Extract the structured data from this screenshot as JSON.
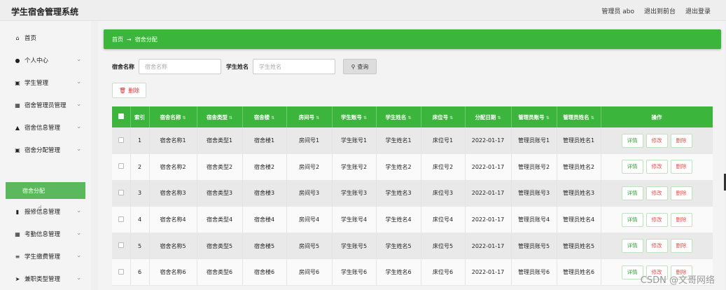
{
  "app": {
    "title": "学生宿舍管理系统",
    "user_label": "管理员 abo",
    "front_link": "退出到前台",
    "logout_link": "退出登录"
  },
  "sidebar": {
    "items": [
      {
        "label": "首页",
        "icon": "home-icon",
        "glyph": "⌂",
        "has_chevron": false
      },
      {
        "label": "个人中心",
        "icon": "user-icon",
        "glyph": "●",
        "has_chevron": true
      },
      {
        "label": "学生管理",
        "icon": "student-icon",
        "glyph": "▣",
        "has_chevron": true
      },
      {
        "label": "宿舍管理员管理",
        "icon": "grid-icon",
        "glyph": "▦",
        "has_chevron": true
      },
      {
        "label": "宿舍信息管理",
        "icon": "building-icon",
        "glyph": "▲",
        "has_chevron": true
      },
      {
        "label": "宿舍分配管理",
        "icon": "assign-icon",
        "glyph": "▣",
        "has_chevron": true
      },
      {
        "label": "卫生检查管理",
        "icon": "grid-icon",
        "glyph": "▦",
        "has_chevron": true
      },
      {
        "label": "报修信息管理",
        "icon": "chart-icon",
        "glyph": "▮",
        "has_chevron": true
      },
      {
        "label": "考勤信息管理",
        "icon": "grid-icon",
        "glyph": "▦",
        "has_chevron": true
      },
      {
        "label": "学生缴费管理",
        "icon": "fee-icon",
        "glyph": "≡",
        "has_chevron": true
      },
      {
        "label": "兼职类型管理",
        "icon": "send-icon",
        "glyph": "➤",
        "has_chevron": true
      }
    ],
    "submenu_active": "宿舍分配"
  },
  "breadcrumb": {
    "home": "首页",
    "arrow": "→",
    "current": "宿舍分配"
  },
  "search": {
    "field1_label": "宿舍名称",
    "field1_placeholder": "宿舍名称",
    "field2_label": "学生姓名",
    "field2_placeholder": "学生姓名",
    "query_label": "查询",
    "query_icon": "search-icon"
  },
  "toolbar": {
    "delete_label": "删除",
    "delete_icon": "trash-icon"
  },
  "table": {
    "columns": [
      "索引",
      "宿舍名称",
      "宿舍类型",
      "宿舍楼",
      "房间号",
      "学生账号",
      "学生姓名",
      "床位号",
      "分配日期",
      "管理员账号",
      "管理员姓名",
      "操作"
    ],
    "rows": [
      [
        "1",
        "宿舍名称1",
        "宿舍类型1",
        "宿舍楼1",
        "房间号1",
        "学生账号1",
        "学生姓名1",
        "床位号1",
        "2022-01-17",
        "管理员账号1",
        "管理员姓名1"
      ],
      [
        "2",
        "宿舍名称2",
        "宿舍类型2",
        "宿舍楼2",
        "房间号2",
        "学生账号2",
        "学生姓名2",
        "床位号2",
        "2022-01-17",
        "管理员账号2",
        "管理员姓名2"
      ],
      [
        "3",
        "宿舍名称3",
        "宿舍类型3",
        "宿舍楼3",
        "房间号3",
        "学生账号3",
        "学生姓名3",
        "床位号3",
        "2022-01-17",
        "管理员账号3",
        "管理员姓名3"
      ],
      [
        "4",
        "宿舍名称4",
        "宿舍类型4",
        "宿舍楼4",
        "房间号4",
        "学生账号4",
        "学生姓名4",
        "床位号4",
        "2022-01-17",
        "管理员账号4",
        "管理员姓名4"
      ],
      [
        "5",
        "宿舍名称5",
        "宿舍类型5",
        "宿舍楼5",
        "房间号5",
        "学生账号5",
        "学生姓名5",
        "床位号5",
        "2022-01-17",
        "管理员账号5",
        "管理员姓名5"
      ],
      [
        "6",
        "宿舍名称6",
        "宿舍类型6",
        "宿舍楼6",
        "房间号6",
        "学生账号6",
        "学生姓名6",
        "床位号6",
        "2022-01-17",
        "管理员账号6",
        "管理员姓名6"
      ]
    ],
    "actions": {
      "detail": "详情",
      "edit": "修改",
      "remove": "删除"
    }
  },
  "watermark": "CSDN @文哥网络",
  "colors": {
    "accent": "#3cb53c",
    "submenu": "#5cb85c",
    "danger": "#d9534f"
  }
}
